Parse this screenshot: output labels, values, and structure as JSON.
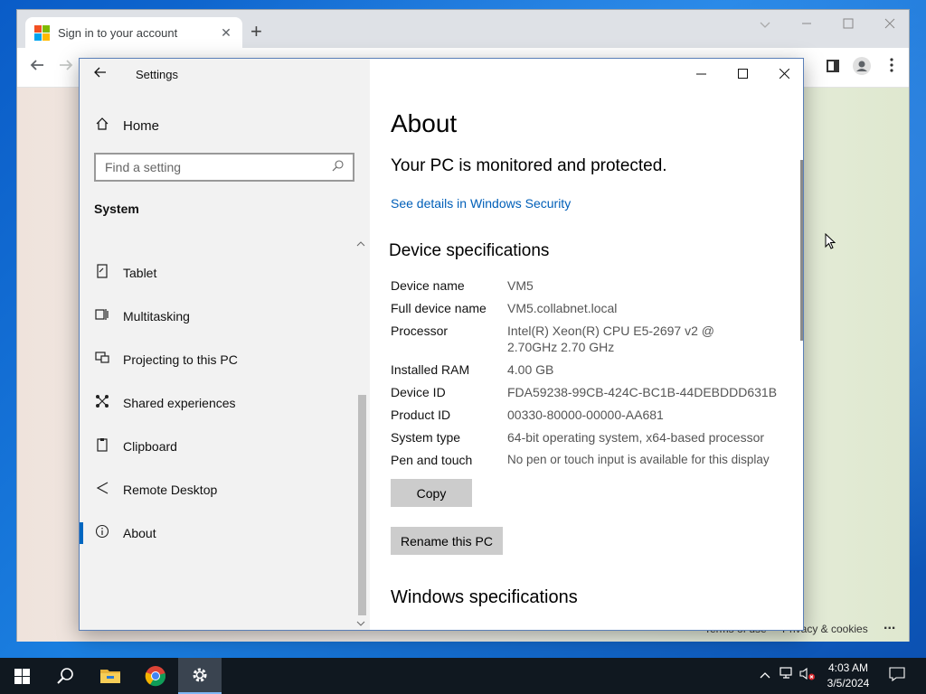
{
  "browser": {
    "tab_title": "Sign in to your account",
    "tab_close": "✕",
    "new_tab": "+",
    "footer_terms": "Terms of use",
    "footer_privacy": "Privacy & cookies",
    "footer_more": "..."
  },
  "settings": {
    "window_title": "Settings",
    "nav": {
      "home_label": "Home",
      "search_placeholder": "Find a setting",
      "section_label": "System",
      "items": [
        {
          "label": "Tablet",
          "icon": "tablet-icon"
        },
        {
          "label": "Multitasking",
          "icon": "multitasking-icon"
        },
        {
          "label": "Projecting to this PC",
          "icon": "projecting-icon"
        },
        {
          "label": "Shared experiences",
          "icon": "shared-experiences-icon"
        },
        {
          "label": "Clipboard",
          "icon": "clipboard-icon"
        },
        {
          "label": "Remote Desktop",
          "icon": "remote-desktop-icon"
        },
        {
          "label": "About",
          "icon": "info-icon",
          "active": true
        }
      ]
    },
    "main": {
      "title": "About",
      "protection_status": "Your PC is monitored and protected.",
      "security_link": "See details in Windows Security",
      "device_specs_heading": "Device specifications",
      "specs": [
        {
          "key": "Device name",
          "value": "VM5"
        },
        {
          "key": "Full device name",
          "value": "VM5.collabnet.local"
        },
        {
          "key": "Processor",
          "value": "Intel(R) Xeon(R) CPU E5-2697 v2 @ 2.70GHz 2.70 GHz"
        },
        {
          "key": "Installed RAM",
          "value": "4.00 GB"
        },
        {
          "key": "Device ID",
          "value": "FDA59238-99CB-424C-BC1B-44DEBDDD631B"
        },
        {
          "key": "Product ID",
          "value": "00330-80000-00000-AA681"
        },
        {
          "key": "System type",
          "value": "64-bit operating system, x64-based processor"
        },
        {
          "key": "Pen and touch",
          "value": "No pen or touch input is available for this display"
        }
      ],
      "copy_button": "Copy",
      "rename_button": "Rename this PC",
      "windows_specs_heading": "Windows specifications"
    }
  },
  "taskbar": {
    "time": "4:03 AM",
    "date": "3/5/2024"
  },
  "colors": {
    "accent": "#0067c0",
    "link": "#005fb8",
    "taskbar": "#101820"
  }
}
